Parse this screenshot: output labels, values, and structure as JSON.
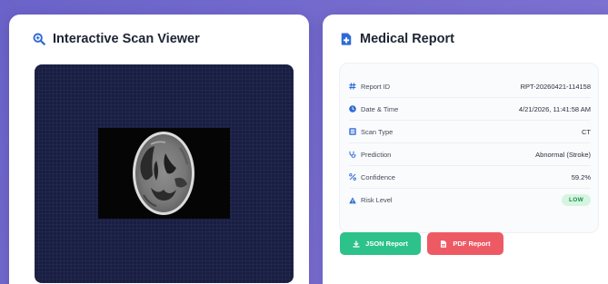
{
  "scan_viewer": {
    "title": "Interactive Scan Viewer",
    "icon": "search-zoom-icon",
    "accent": "#2f6ad6"
  },
  "report": {
    "title": "Medical Report",
    "icon": "medical-file-icon",
    "rows": [
      {
        "icon": "hash-icon",
        "label": "Report ID",
        "value": "RPT-20260421-114158"
      },
      {
        "icon": "clock-icon",
        "label": "Date & Time",
        "value": "4/21/2026, 11:41:58 AM"
      },
      {
        "icon": "scan-icon",
        "label": "Scan Type",
        "value": "CT"
      },
      {
        "icon": "stethoscope-icon",
        "label": "Prediction",
        "value": "Abnormal (Stroke)"
      },
      {
        "icon": "percent-icon",
        "label": "Confidence",
        "value": "59.2%"
      },
      {
        "icon": "warning-icon",
        "label": "Risk Level",
        "value": "LOW"
      }
    ],
    "buttons": {
      "json_label": "JSON Report",
      "pdf_label": "PDF Report"
    }
  },
  "colors": {
    "background": "#7068cc",
    "json_button": "#2dc28a",
    "pdf_button": "#ee5a64",
    "risk_low_badge": "#d6f5e0",
    "icon_blue": "#2f6ad6"
  }
}
